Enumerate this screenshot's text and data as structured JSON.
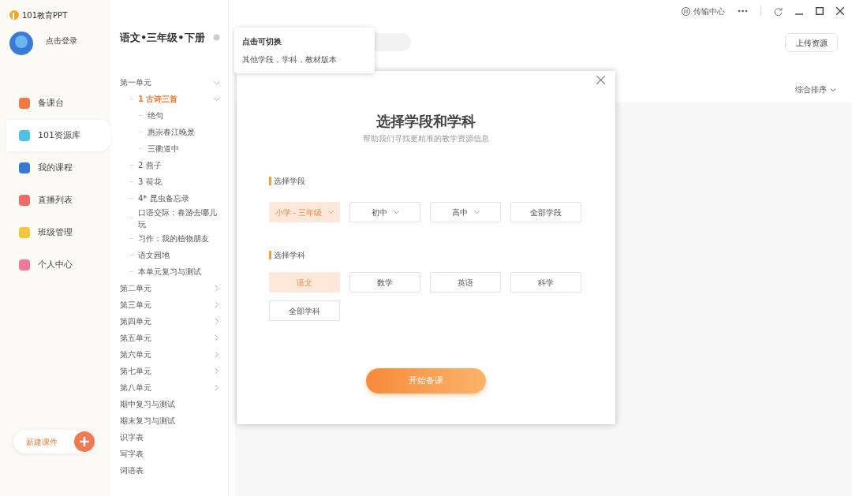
{
  "app": {
    "name": "101教育PPT",
    "login": "点击登录"
  },
  "nav": [
    {
      "label": "备课台",
      "selected": false,
      "color": "#f07a45"
    },
    {
      "label": "101资源库",
      "selected": true,
      "color": "#4cc3e6"
    },
    {
      "label": "我的课程",
      "selected": false,
      "color": "#3a78d8"
    },
    {
      "label": "直播列表",
      "selected": false,
      "color": "#f06a6a"
    },
    {
      "label": "班级管理",
      "selected": false,
      "color": "#f5c63c"
    },
    {
      "label": "个人中心",
      "selected": false,
      "color": "#f07a9a"
    }
  ],
  "new_button": "新建课件",
  "book": {
    "title": "语文•三年级•下册"
  },
  "tree": [
    {
      "label": "第一单元",
      "expanded": true,
      "selected": false,
      "children": [
        {
          "label": "1 古诗三首",
          "expanded": true,
          "selected": true,
          "children": [
            {
              "label": "绝句",
              "selected": false
            },
            {
              "label": "惠崇春江晚景",
              "selected": false
            },
            {
              "label": "三衢道中",
              "selected": false
            }
          ]
        },
        {
          "label": "2 燕子",
          "selected": false
        },
        {
          "label": "3 荷花",
          "selected": false
        },
        {
          "label": "4* 昆虫备忘录",
          "selected": false
        },
        {
          "label": "口语交际：春游去哪儿玩",
          "selected": false
        },
        {
          "label": "习作：我的植物朋友",
          "selected": false
        },
        {
          "label": "语文园地",
          "selected": false
        },
        {
          "label": "本单元复习与测试",
          "selected": false
        }
      ]
    },
    {
      "label": "第二单元",
      "expanded": false,
      "selected": false
    },
    {
      "label": "第三单元",
      "expanded": false,
      "selected": false
    },
    {
      "label": "第四单元",
      "expanded": false,
      "selected": false
    },
    {
      "label": "第五单元",
      "expanded": false,
      "selected": false
    },
    {
      "label": "第六单元",
      "expanded": false,
      "selected": false
    },
    {
      "label": "第七单元",
      "expanded": false,
      "selected": false
    },
    {
      "label": "第八单元",
      "expanded": false,
      "selected": false
    },
    {
      "label": "期中复习与测试",
      "selected": false
    },
    {
      "label": "期末复习与测试",
      "selected": false
    },
    {
      "label": "识字表",
      "selected": false
    },
    {
      "label": "写字表",
      "selected": false
    },
    {
      "label": "词语表",
      "selected": false
    }
  ],
  "titlebar": {
    "transfer": "传输中心"
  },
  "upload_button": "上传资源",
  "sort": "综合排序",
  "tooltip": {
    "title": "点击可切换",
    "text": "其他学段，学科，教材版本"
  },
  "dialog": {
    "title": "选择学段和学科",
    "subtitle": "帮助我们寻找更精准的教学资源信息",
    "stage_label": "选择学段",
    "stages": [
      {
        "label": "小学 - 三年级",
        "kind": "dropdown",
        "selected": true
      },
      {
        "label": "初中",
        "kind": "dropdown",
        "selected": false
      },
      {
        "label": "高中",
        "kind": "dropdown",
        "selected": false
      },
      {
        "label": "全部学段",
        "kind": "button",
        "selected": false
      }
    ],
    "subject_label": "选择学科",
    "subjects": [
      {
        "label": "语文",
        "selected": true
      },
      {
        "label": "数学",
        "selected": false
      },
      {
        "label": "英语",
        "selected": false
      },
      {
        "label": "科学",
        "selected": false
      },
      {
        "label": "全部学科",
        "selected": false
      }
    ],
    "start_button": "开始备课"
  }
}
